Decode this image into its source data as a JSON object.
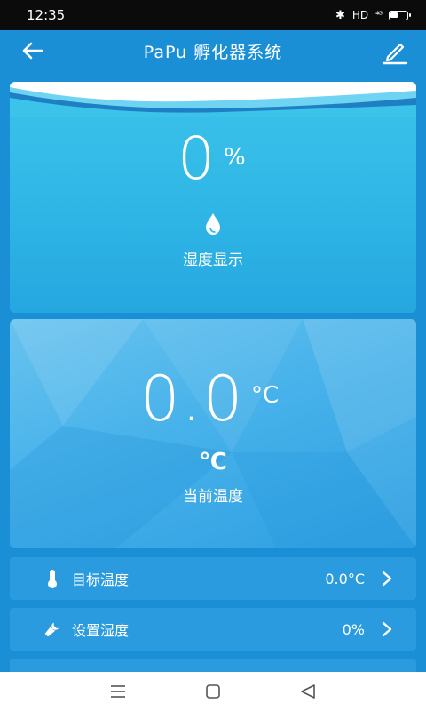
{
  "status_bar": {
    "time": "12:35",
    "bluetooth": "✱",
    "hd": "HD",
    "signal": "⁴ᴳ"
  },
  "app_bar": {
    "title": "PaPu 孵化器系统",
    "back_icon": "arrow-left-icon",
    "edit_icon": "pencil-icon"
  },
  "humidity_card": {
    "value": "0",
    "unit": "%",
    "icon": "water-drop-icon",
    "label": "湿度显示"
  },
  "temperature_card": {
    "value": "0.0",
    "unit": "°C",
    "icon_text": "℃",
    "label": "当前温度"
  },
  "settings": {
    "target_temp": {
      "label": "目标温度",
      "value": "0.0°C",
      "icon": "thermometer-icon"
    },
    "set_humidity": {
      "label": "设置湿度",
      "value": "0%",
      "icon": "wrench-icon"
    }
  },
  "nav": {
    "menu_icon": "menu-icon",
    "home_icon": "home-square-icon",
    "back_icon": "back-triangle-icon"
  },
  "colors": {
    "primary": "#1a8fd6",
    "card_humidity": "#2fb6e6",
    "card_temperature": "#47b2ea",
    "row": "#2b9be0"
  }
}
